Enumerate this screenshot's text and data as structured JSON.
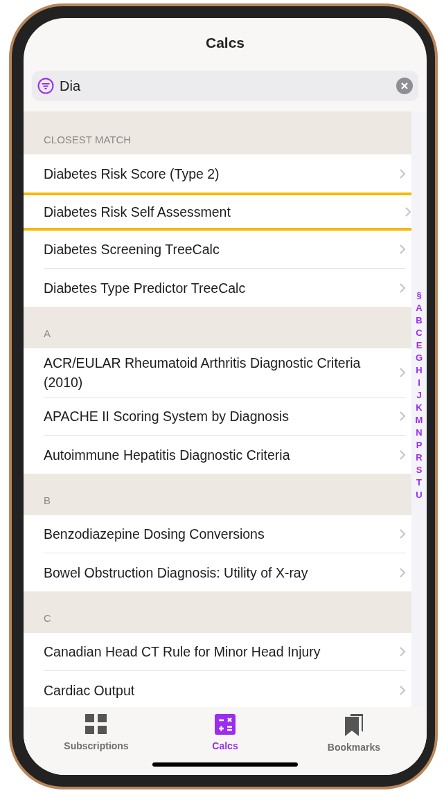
{
  "title": "Calcs",
  "search": {
    "value": "Dia"
  },
  "sections": [
    {
      "header": "CLOSEST MATCH",
      "rows": [
        {
          "label": "Diabetes Risk Score (Type 2)",
          "highlighted": false
        },
        {
          "label": "Diabetes Risk Self Assessment",
          "highlighted": true
        },
        {
          "label": "Diabetes Screening TreeCalc",
          "highlighted": false
        },
        {
          "label": "Diabetes Type Predictor TreeCalc",
          "highlighted": false
        }
      ]
    },
    {
      "header": "A",
      "rows": [
        {
          "label": "ACR/EULAR Rheumatoid Arthritis Diagnostic Criteria (2010)",
          "highlighted": false
        },
        {
          "label": "APACHE II Scoring System by Diagnosis",
          "highlighted": false
        },
        {
          "label": "Autoimmune Hepatitis Diagnostic Criteria",
          "highlighted": false
        }
      ]
    },
    {
      "header": "B",
      "rows": [
        {
          "label": "Benzodiazepine Dosing Conversions",
          "highlighted": false
        },
        {
          "label": "Bowel Obstruction Diagnosis: Utility of X-ray",
          "highlighted": false
        }
      ]
    },
    {
      "header": "C",
      "rows": [
        {
          "label": "Canadian Head CT Rule for Minor Head Injury",
          "highlighted": false
        },
        {
          "label": "Cardiac Output",
          "highlighted": false
        }
      ]
    }
  ],
  "index": [
    "§",
    "A",
    "B",
    "C",
    "E",
    "G",
    "H",
    "I",
    "J",
    "K",
    "M",
    "N",
    "P",
    "R",
    "S",
    "T",
    "U"
  ],
  "tabs": [
    {
      "label": "Subscriptions",
      "kind": "grid",
      "selected": false
    },
    {
      "label": "Calcs",
      "kind": "calc",
      "selected": true
    },
    {
      "label": "Bookmarks",
      "kind": "bookmarks",
      "selected": false
    }
  ]
}
